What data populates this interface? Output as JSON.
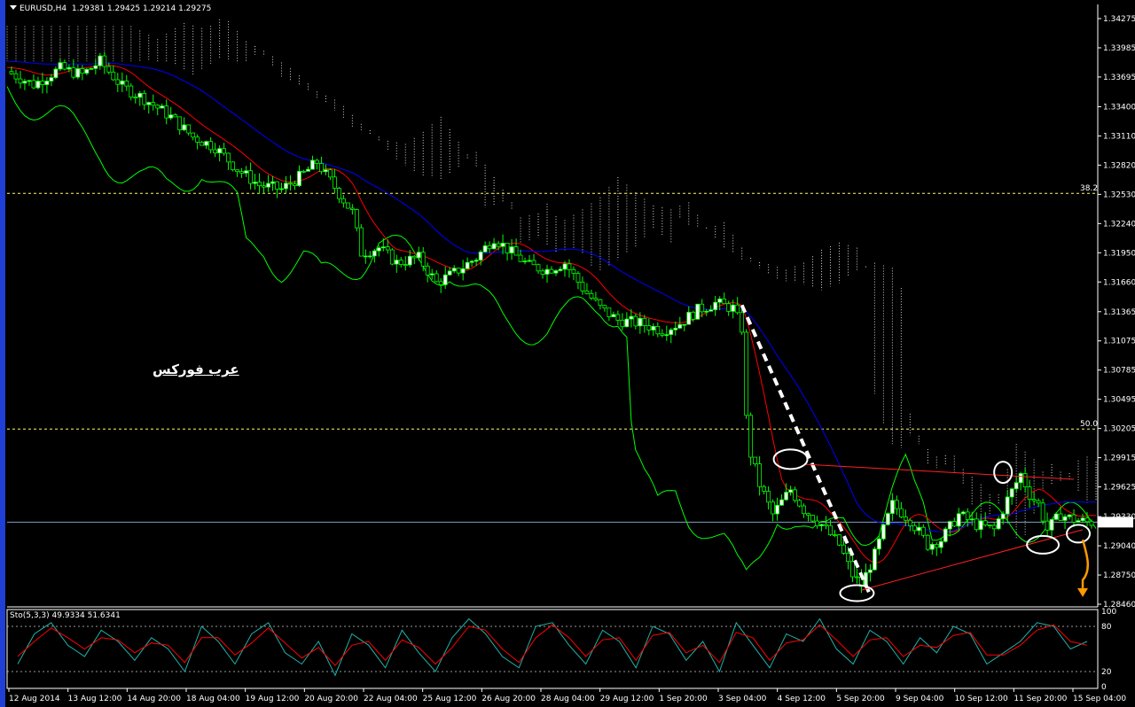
{
  "header": {
    "symbol": "EURUSD,H4",
    "quote": "1.29381 1.29425 1.29214 1.29275"
  },
  "watermark": "عرب فوركس",
  "stochastic": {
    "label": "Sto(5,3,3) 49.9334 51.6341"
  },
  "colors": {
    "background": "#000000",
    "bull_candle": "#ffffff",
    "bear_candle": "#000000",
    "candle_outline": "#00ff00",
    "tenkan": "#ff0000",
    "kijun": "#0000ff",
    "chikou": "#00ff00",
    "kumo": "#ffffff",
    "fib_line": "#ffff66",
    "current_price_line": "#7f9fbf",
    "trendline": "#ff2020",
    "drawn_line": "#ffffff",
    "arrow": "#ff9900",
    "stoch_main": "#20b2aa",
    "stoch_signal": "#ff0000"
  },
  "chart_data": {
    "type": "candlestick",
    "symbol": "EURUSD",
    "timeframe": "H4",
    "ylim": [
      1.2846,
      1.3428
    ],
    "price_ticks": [
      "1.34275",
      "1.33985",
      "1.33695",
      "1.33400",
      "1.33110",
      "1.32820",
      "1.32530",
      "1.32240",
      "1.31950",
      "1.31660",
      "1.31365",
      "1.31075",
      "1.30785",
      "1.30495",
      "1.30205",
      "1.29915",
      "1.29625",
      "1.29330",
      "1.29040",
      "1.28750",
      "1.28460"
    ],
    "current_price": "1.29275",
    "fib_levels": [
      {
        "label": "38.2",
        "price": 1.3254
      },
      {
        "label": "50.0",
        "price": 1.302
      }
    ],
    "time_labels": [
      "12 Aug 2014",
      "13 Aug 12:00",
      "14 Aug 20:00",
      "18 Aug 04:00",
      "19 Aug 12:00",
      "20 Aug 20:00",
      "22 Aug 04:00",
      "25 Aug 12:00",
      "26 Aug 20:00",
      "28 Aug 04:00",
      "29 Aug 12:00",
      "1 Sep 20:00",
      "3 Sep 04:00",
      "4 Sep 12:00",
      "5 Sep 20:00",
      "9 Sep 04:00",
      "10 Sep 12:00",
      "11 Sep 20:00",
      "15 Sep 04:00"
    ],
    "close_path": [
      [
        0,
        1.3375
      ],
      [
        6,
        1.3362
      ],
      [
        12,
        1.3378
      ],
      [
        17,
        1.3372
      ],
      [
        21,
        1.3385
      ],
      [
        26,
        1.336
      ],
      [
        31,
        1.3348
      ],
      [
        37,
        1.333
      ],
      [
        42,
        1.331
      ],
      [
        47,
        1.33
      ],
      [
        52,
        1.3278
      ],
      [
        57,
        1.3262
      ],
      [
        62,
        1.3258
      ],
      [
        66,
        1.327
      ],
      [
        70,
        1.3285
      ],
      [
        74,
        1.326
      ],
      [
        78,
        1.3235
      ],
      [
        80,
        1.3195
      ],
      [
        84,
        1.32
      ],
      [
        88,
        1.3185
      ],
      [
        93,
        1.319
      ],
      [
        97,
        1.3165
      ],
      [
        101,
        1.3175
      ],
      [
        106,
        1.319
      ],
      [
        110,
        1.321
      ],
      [
        114,
        1.3195
      ],
      [
        118,
        1.3182
      ],
      [
        122,
        1.3178
      ],
      [
        126,
        1.3185
      ],
      [
        130,
        1.316
      ],
      [
        134,
        1.314
      ],
      [
        138,
        1.3128
      ],
      [
        143,
        1.3125
      ],
      [
        148,
        1.3118
      ],
      [
        152,
        1.3125
      ],
      [
        156,
        1.3138
      ],
      [
        160,
        1.3145
      ],
      [
        164,
        1.314
      ],
      [
        166,
        1.312
      ],
      [
        167,
        1.303
      ],
      [
        168,
        1.2995
      ],
      [
        170,
        1.2965
      ],
      [
        173,
        1.2935
      ],
      [
        177,
        1.296
      ],
      [
        180,
        1.294
      ],
      [
        184,
        1.2925
      ],
      [
        188,
        1.2905
      ],
      [
        191,
        1.2875
      ],
      [
        193,
        1.2865
      ],
      [
        196,
        1.2895
      ],
      [
        200,
        1.2945
      ],
      [
        204,
        1.293
      ],
      [
        208,
        1.2905
      ],
      [
        211,
        1.291
      ],
      [
        215,
        1.2935
      ],
      [
        219,
        1.2925
      ],
      [
        223,
        1.292
      ],
      [
        226,
        1.295
      ],
      [
        229,
        1.2975
      ],
      [
        231,
        1.2955
      ],
      [
        233,
        1.2945
      ],
      [
        235,
        1.292
      ],
      [
        238,
        1.2935
      ],
      [
        241,
        1.293
      ],
      [
        244,
        1.29275
      ]
    ],
    "stoch_levels": [
      100,
      80,
      20,
      0
    ],
    "stoch_main": [
      30,
      70,
      85,
      55,
      40,
      75,
      60,
      35,
      65,
      50,
      20,
      80,
      60,
      30,
      70,
      85,
      45,
      30,
      60,
      15,
      70,
      55,
      25,
      75,
      45,
      20,
      65,
      90,
      70,
      40,
      25,
      80,
      85,
      55,
      30,
      75,
      60,
      25,
      80,
      70,
      35,
      60,
      20,
      85,
      55,
      25,
      70,
      60,
      90,
      50,
      30,
      75,
      60,
      30,
      65,
      45,
      80,
      70,
      30,
      45,
      60,
      85,
      80,
      50,
      60
    ],
    "stoch_signal": [
      40,
      60,
      78,
      65,
      50,
      65,
      62,
      45,
      58,
      55,
      32,
      65,
      65,
      42,
      58,
      78,
      58,
      38,
      52,
      28,
      55,
      60,
      35,
      62,
      52,
      30,
      52,
      80,
      75,
      50,
      32,
      65,
      82,
      65,
      40,
      62,
      65,
      35,
      68,
      72,
      45,
      55,
      32,
      72,
      65,
      35,
      58,
      62,
      82,
      62,
      40,
      62,
      65,
      40,
      55,
      52,
      68,
      72,
      42,
      42,
      55,
      75,
      82,
      60,
      55
    ]
  }
}
